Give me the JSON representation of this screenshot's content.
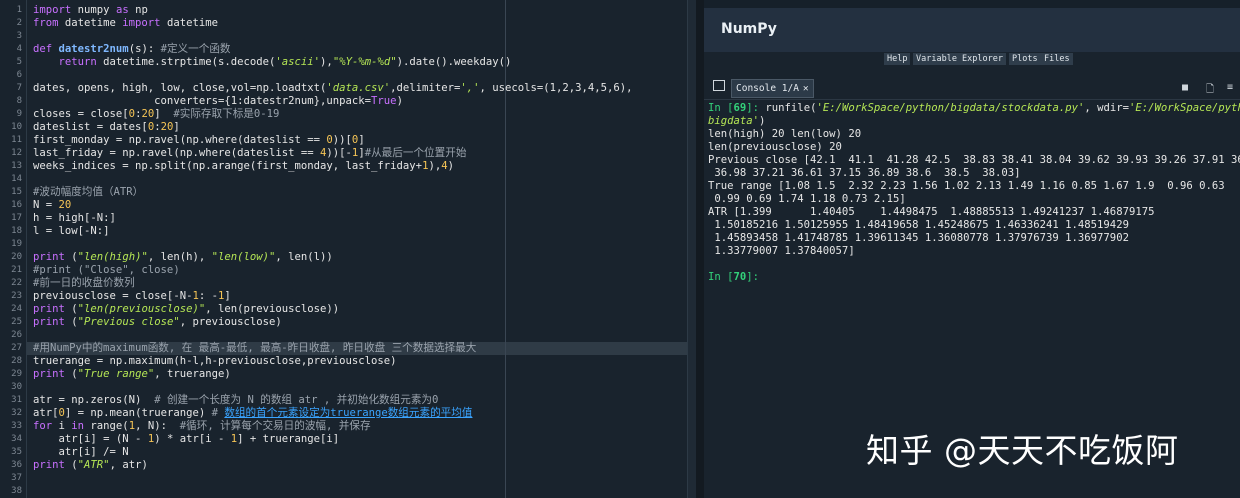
{
  "editor": {
    "line_numbers": [
      "1",
      "2",
      "3",
      "4",
      "5",
      "6",
      "7",
      "8",
      "9",
      "10",
      "11",
      "12",
      "13",
      "14",
      "15",
      "16",
      "17",
      "18",
      "19",
      "20",
      "21",
      "22",
      "23",
      "24",
      "25",
      "26",
      "27",
      "28",
      "29",
      "30",
      "31",
      "32",
      "33",
      "34",
      "35",
      "36",
      "37",
      "38"
    ],
    "lines": [
      {
        "tokens": [
          {
            "t": "import ",
            "c": "kw"
          },
          {
            "t": "numpy "
          },
          {
            "t": "as ",
            "c": "kw"
          },
          {
            "t": "np"
          }
        ]
      },
      {
        "tokens": [
          {
            "t": "from ",
            "c": "kw"
          },
          {
            "t": "datetime "
          },
          {
            "t": "import ",
            "c": "kw"
          },
          {
            "t": "datetime"
          }
        ]
      },
      {
        "tokens": []
      },
      {
        "tokens": [
          {
            "t": "def ",
            "c": "kw"
          },
          {
            "t": "datestr2num",
            "c": "fn"
          },
          {
            "t": "(s): "
          },
          {
            "t": "#定义一个函数",
            "c": "cm"
          }
        ]
      },
      {
        "tokens": [
          {
            "t": "    "
          },
          {
            "t": "return ",
            "c": "kw"
          },
          {
            "t": "datetime.strptime(s.decode("
          },
          {
            "t": "'ascii'",
            "c": "st"
          },
          {
            "t": "),"
          },
          {
            "t": "\"%Y-%m-%d\"",
            "c": "st"
          },
          {
            "t": ").date().weekday()"
          }
        ]
      },
      {
        "tokens": []
      },
      {
        "tokens": [
          {
            "t": "dates, opens, high, low, close,vol=np.loadtxt("
          },
          {
            "t": "'data.csv'",
            "c": "st"
          },
          {
            "t": ",delimiter="
          },
          {
            "t": "','",
            "c": "st"
          },
          {
            "t": ", usecols=(1,2,3,4,5,6),"
          }
        ]
      },
      {
        "tokens": [
          {
            "t": "                   converters={1:datestr2num},unpack="
          },
          {
            "t": "True",
            "c": "kw"
          },
          {
            "t": ")"
          }
        ]
      },
      {
        "tokens": [
          {
            "t": "closes = close["
          },
          {
            "t": "0",
            "c": "nm"
          },
          {
            "t": ":"
          },
          {
            "t": "20",
            "c": "nm"
          },
          {
            "t": "]  "
          },
          {
            "t": "#实际存取下标是0-19",
            "c": "cm"
          }
        ]
      },
      {
        "tokens": [
          {
            "t": "dateslist = dates["
          },
          {
            "t": "0",
            "c": "nm"
          },
          {
            "t": ":"
          },
          {
            "t": "20",
            "c": "nm"
          },
          {
            "t": "]"
          }
        ]
      },
      {
        "tokens": [
          {
            "t": "first_monday = np.ravel(np.where(dateslist == "
          },
          {
            "t": "0",
            "c": "nm"
          },
          {
            "t": "))["
          },
          {
            "t": "0",
            "c": "nm"
          },
          {
            "t": "]"
          }
        ]
      },
      {
        "tokens": [
          {
            "t": "last_friday = np.ravel(np.where(dateslist == "
          },
          {
            "t": "4",
            "c": "nm"
          },
          {
            "t": "))[-"
          },
          {
            "t": "1",
            "c": "nm"
          },
          {
            "t": "]"
          },
          {
            "t": "#从最后一个位置开始",
            "c": "cm"
          }
        ]
      },
      {
        "tokens": [
          {
            "t": "weeks_indices = np.split(np.arange(first_monday, last_friday+"
          },
          {
            "t": "1",
            "c": "nm"
          },
          {
            "t": "),"
          },
          {
            "t": "4",
            "c": "nm"
          },
          {
            "t": ")"
          }
        ]
      },
      {
        "tokens": []
      },
      {
        "tokens": [
          {
            "t": "#波动幅度均值（ATR）",
            "c": "cm"
          }
        ]
      },
      {
        "tokens": [
          {
            "t": "N = "
          },
          {
            "t": "20",
            "c": "nm"
          }
        ]
      },
      {
        "tokens": [
          {
            "t": "h = high[-N:]"
          }
        ]
      },
      {
        "tokens": [
          {
            "t": "l = low[-N:]"
          }
        ]
      },
      {
        "tokens": []
      },
      {
        "tokens": [
          {
            "t": "print ",
            "c": "kw"
          },
          {
            "t": "("
          },
          {
            "t": "\"len(high)\"",
            "c": "st"
          },
          {
            "t": ", len(h), "
          },
          {
            "t": "\"len(low)\"",
            "c": "st"
          },
          {
            "t": ", len(l))"
          }
        ]
      },
      {
        "tokens": [
          {
            "t": "#print (\"Close\", close)",
            "c": "cm"
          }
        ]
      },
      {
        "tokens": [
          {
            "t": "#前一日的收盘价数列",
            "c": "cm"
          }
        ]
      },
      {
        "tokens": [
          {
            "t": "previousclose = close[-N-"
          },
          {
            "t": "1",
            "c": "nm"
          },
          {
            "t": ": -"
          },
          {
            "t": "1",
            "c": "nm"
          },
          {
            "t": "]"
          }
        ]
      },
      {
        "tokens": [
          {
            "t": "print ",
            "c": "kw"
          },
          {
            "t": "("
          },
          {
            "t": "\"len(previousclose)\"",
            "c": "st"
          },
          {
            "t": ", len(previousclose))"
          }
        ]
      },
      {
        "tokens": [
          {
            "t": "print ",
            "c": "kw"
          },
          {
            "t": "("
          },
          {
            "t": "\"Previous close\"",
            "c": "st"
          },
          {
            "t": ", previousclose)"
          }
        ]
      },
      {
        "tokens": []
      },
      {
        "tokens": [
          {
            "t": "#用NumPy中的maximum函数, 在 最高-最低, 最高-昨日收盘, 昨日收盘 三个数据选择最大",
            "c": "cm"
          }
        ]
      },
      {
        "tokens": [
          {
            "t": "truerange = np.maximum(h-l,h-previousclose,previousclose)"
          }
        ]
      },
      {
        "tokens": [
          {
            "t": "print ",
            "c": "kw"
          },
          {
            "t": "("
          },
          {
            "t": "\"True range\"",
            "c": "st"
          },
          {
            "t": ", truerange)"
          }
        ]
      },
      {
        "tokens": []
      },
      {
        "tokens": [
          {
            "t": "atr = np.zeros(N)  "
          },
          {
            "t": "# 创建一个长度为 N 的数组 atr , 并初始化数组元素为0",
            "c": "cm"
          }
        ]
      },
      {
        "tokens": [
          {
            "t": "atr["
          },
          {
            "t": "0",
            "c": "nm"
          },
          {
            "t": "] = np.mean(truerange) "
          },
          {
            "t": "# ",
            "c": "cm"
          },
          {
            "t": "数组的首个元素设定为truerange数组元素的平均值",
            "c": "link"
          }
        ]
      },
      {
        "tokens": [
          {
            "t": "for ",
            "c": "kw"
          },
          {
            "t": "i "
          },
          {
            "t": "in ",
            "c": "kw"
          },
          {
            "t": "range("
          },
          {
            "t": "1",
            "c": "nm"
          },
          {
            "t": ", N):  "
          },
          {
            "t": "#循环, 计算每个交易日的波幅, 并保存",
            "c": "cm"
          }
        ]
      },
      {
        "tokens": [
          {
            "t": "    atr[i] = (N - "
          },
          {
            "t": "1",
            "c": "nm"
          },
          {
            "t": ") * atr[i - "
          },
          {
            "t": "1",
            "c": "nm"
          },
          {
            "t": "] + truerange[i]"
          }
        ]
      },
      {
        "tokens": [
          {
            "t": "    atr[i] /= N"
          }
        ]
      },
      {
        "tokens": [
          {
            "t": "print ",
            "c": "kw"
          },
          {
            "t": "("
          },
          {
            "t": "\"ATR\"",
            "c": "st"
          },
          {
            "t": ", atr)"
          }
        ]
      },
      {
        "tokens": []
      },
      {
        "tokens": []
      }
    ]
  },
  "help": {
    "title": "NumPy",
    "tabs": [
      "Help",
      "Variable Explorer",
      "Plots",
      "Files"
    ]
  },
  "console": {
    "tab_label": "Console 1/A",
    "tab_close": "✕",
    "buttons": {
      "stop": "■",
      "copy": "🗋",
      "menu": "≡"
    },
    "lines": [
      {
        "tokens": [
          {
            "t": "In [",
            "c": "prompt"
          },
          {
            "t": "69",
            "c": "pnum"
          },
          {
            "t": "]: ",
            "c": "prompt"
          },
          {
            "t": "runfile("
          },
          {
            "t": "'E:/WorkSpace/python/bigdata/stockdata.py'",
            "c": "it"
          },
          {
            "t": ", wdir="
          },
          {
            "t": "'E:/WorkSpace/python/",
            "c": "it"
          }
        ]
      },
      {
        "tokens": [
          {
            "t": "bigdata'",
            "c": "it"
          },
          {
            "t": ")"
          }
        ]
      },
      {
        "tokens": [
          {
            "t": "len(high) 20 len(low) 20"
          }
        ]
      },
      {
        "tokens": [
          {
            "t": "len(previousclose) 20"
          }
        ]
      },
      {
        "tokens": [
          {
            "t": "Previous close [42.1  41.1  41.28 42.5  38.83 38.41 38.04 39.62 39.93 39.26 37.91 36.47"
          }
        ]
      },
      {
        "tokens": [
          {
            "t": " 36.98 37.21 36.61 37.15 36.89 38.6  38.5  38.03]"
          }
        ]
      },
      {
        "tokens": [
          {
            "t": "True range [1.08 1.5  2.32 2.23 1.56 1.02 2.13 1.49 1.16 0.85 1.67 1.9  0.96 0.63"
          }
        ]
      },
      {
        "tokens": [
          {
            "t": " 0.99 0.69 1.74 1.18 0.73 2.15]"
          }
        ]
      },
      {
        "tokens": [
          {
            "t": "ATR [1.399      1.40405    1.4498475  1.48885513 1.49241237 1.46879175"
          }
        ]
      },
      {
        "tokens": [
          {
            "t": " 1.50185216 1.50125955 1.48419658 1.45248675 1.46336241 1.48519429"
          }
        ]
      },
      {
        "tokens": [
          {
            "t": " 1.45893458 1.41748785 1.39611345 1.36080778 1.37976739 1.36977902"
          }
        ]
      },
      {
        "tokens": [
          {
            "t": " 1.33779007 1.37840057]"
          }
        ]
      },
      {
        "tokens": []
      },
      {
        "tokens": [
          {
            "t": "In [",
            "c": "prompt"
          },
          {
            "t": "70",
            "c": "pnum"
          },
          {
            "t": "]:",
            "c": "prompt"
          }
        ]
      }
    ]
  },
  "watermark": "知乎 @天天不吃饭阿"
}
